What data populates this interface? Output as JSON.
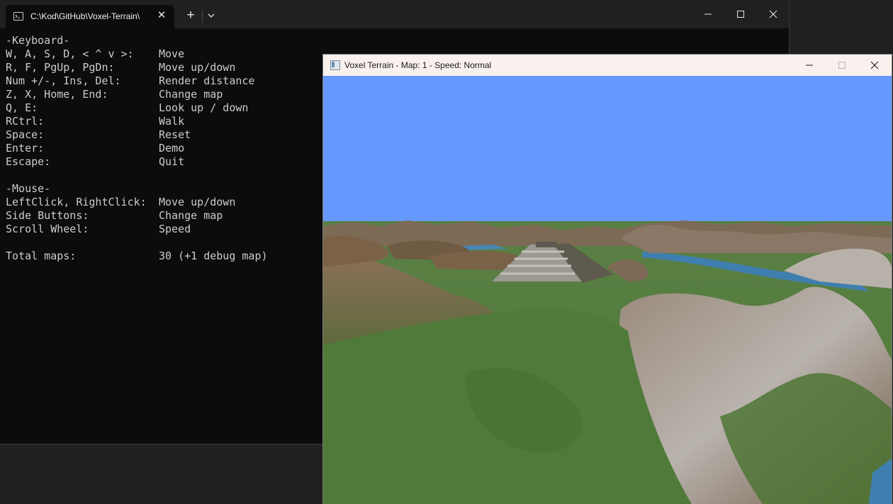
{
  "terminal": {
    "tab_title": "C:\\Kod\\GitHub\\Voxel-Terrain\\",
    "close_glyph": "✕",
    "new_tab_glyph": "+",
    "rows": [
      {
        "k": "-Keyboard-",
        "v": ""
      },
      {
        "k": "W, A, S, D, < ^ v >:",
        "v": "Move"
      },
      {
        "k": "R, F, PgUp, PgDn:",
        "v": "Move up/down"
      },
      {
        "k": "Num +/-, Ins, Del:",
        "v": "Render distance"
      },
      {
        "k": "Z, X, Home, End:",
        "v": "Change map"
      },
      {
        "k": "Q, E:",
        "v": "Look up / down"
      },
      {
        "k": "RCtrl:",
        "v": "Walk"
      },
      {
        "k": "Space:",
        "v": "Reset"
      },
      {
        "k": "Enter:",
        "v": "Demo"
      },
      {
        "k": "Escape:",
        "v": "Quit"
      },
      {
        "k": "",
        "v": ""
      },
      {
        "k": "-Mouse-",
        "v": ""
      },
      {
        "k": "LeftClick, RightClick:",
        "v": "Move up/down"
      },
      {
        "k": "Side Buttons:",
        "v": "Change map"
      },
      {
        "k": "Scroll Wheel:",
        "v": "Speed"
      },
      {
        "k": "",
        "v": ""
      },
      {
        "k": "Total maps:",
        "v": "30 (+1 debug map)"
      }
    ]
  },
  "game": {
    "title": "Voxel Terrain - Map: 1 - Speed: Normal",
    "colors": {
      "sky": "#6699ff",
      "grass": "#4f7a3a",
      "mountain": "#7a6046",
      "snow": "#b9b3ad",
      "water": "#3f7fb0"
    }
  }
}
